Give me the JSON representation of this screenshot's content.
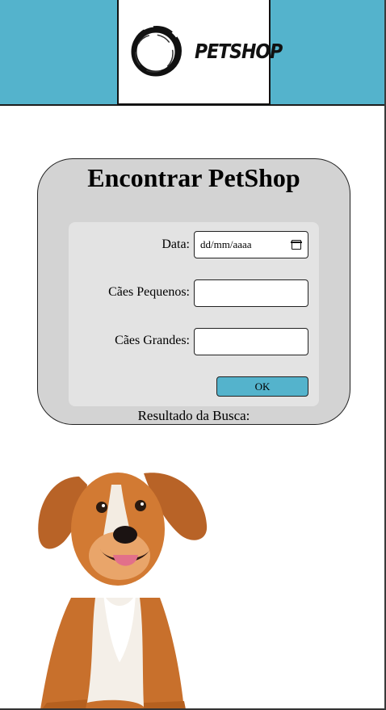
{
  "colors": {
    "header_bg": "#54b3cc",
    "card_bg": "#d3d3d3",
    "panel_bg": "#e3e3e3",
    "button_bg": "#54b3cc"
  },
  "header": {
    "logo_text": "PETSHOP"
  },
  "card": {
    "title": "Encontrar PetShop",
    "form": {
      "date_label": "Data:",
      "date_placeholder": "dd/mm/aaaa",
      "small_dogs_label": "Cães Pequenos:",
      "small_dogs_value": "",
      "large_dogs_label": "Cães Grandes:",
      "large_dogs_value": "",
      "ok_label": "OK"
    },
    "result_label": "Resultado da Busca:"
  },
  "icons": {
    "logo": "ring-logo-icon",
    "calendar": "calendar-icon",
    "dog": "dog-image"
  }
}
